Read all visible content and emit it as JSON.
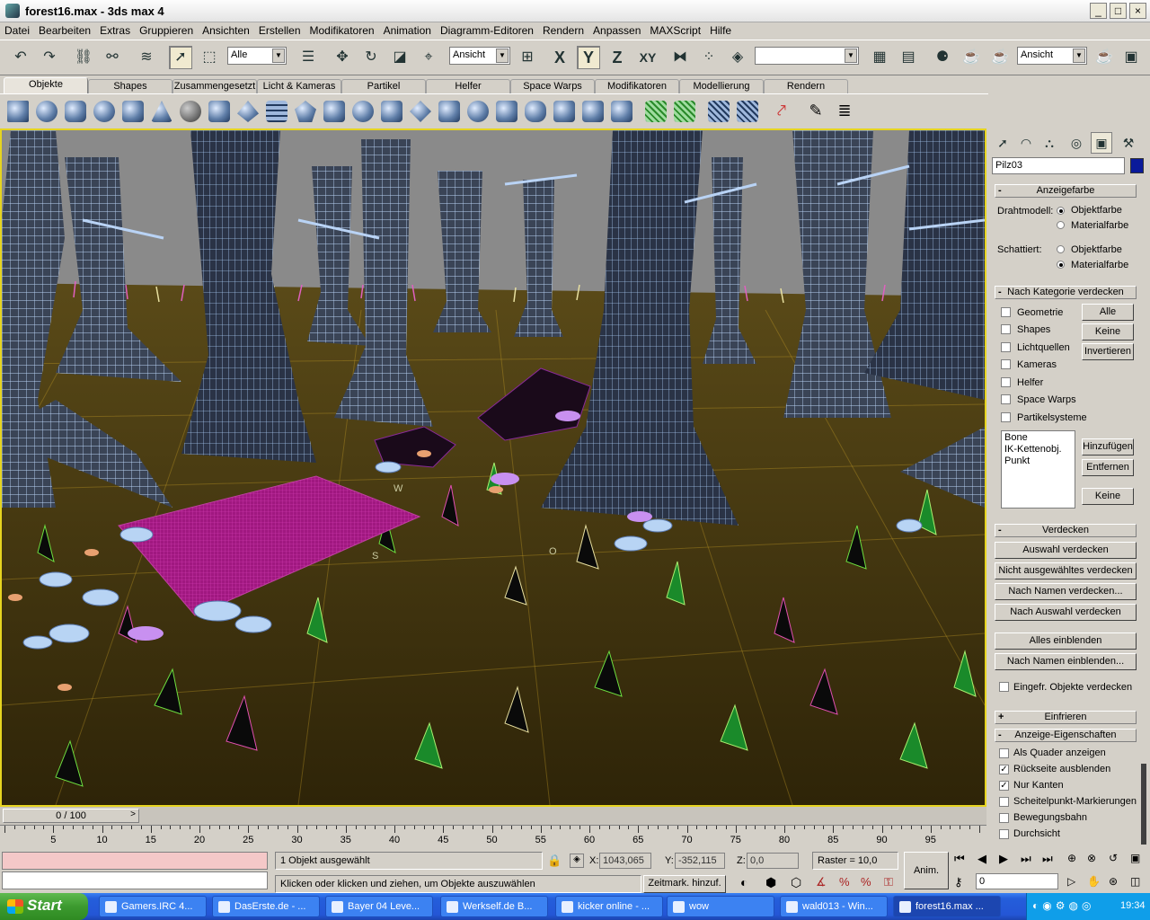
{
  "window": {
    "title": "forest16.max - 3ds max 4"
  },
  "menu": [
    "Datei",
    "Bearbeiten",
    "Extras",
    "Gruppieren",
    "Ansichten",
    "Erstellen",
    "Modifikatoren",
    "Animation",
    "Diagramm-Editoren",
    "Rendern",
    "Anpassen",
    "MAXScript",
    "Hilfe"
  ],
  "toolbar": {
    "filter": "Alle",
    "refcoord": "Ansicht",
    "axis_x": "X",
    "axis_y": "Y",
    "axis_z": "Z",
    "axis_xy": "XY",
    "render_view": "Ansicht"
  },
  "tabs": [
    "Objekte",
    "Shapes",
    "Zusammengesetzt",
    "Licht & Kameras",
    "Partikel",
    "Helfer",
    "Space Warps",
    "Modifikatoren",
    "Modellierung",
    "Rendern"
  ],
  "panel": {
    "object_name": "Pilz03",
    "rollout_display_color": "Anzeigefarbe",
    "wireframe_label": "Drahtmodell:",
    "shaded_label": "Schattiert:",
    "opt_object_color": "Objektfarbe",
    "opt_material_color": "Materialfarbe",
    "rollout_hide_by_category": "Nach Kategorie verdecken",
    "categories": [
      "Geometrie",
      "Shapes",
      "Lichtquellen",
      "Kameras",
      "Helfer",
      "Space Warps",
      "Partikelsysteme"
    ],
    "btn_all": "Alle",
    "btn_none": "Keine",
    "btn_invert": "Invertieren",
    "list_items": [
      "Bone",
      "IK-Kettenobj.",
      "Punkt"
    ],
    "btn_add": "Hinzufügen",
    "btn_remove": "Entfernen",
    "btn_none2": "Keine",
    "rollout_hide": "Verdecken",
    "btn_hide_sel": "Auswahl verdecken",
    "btn_hide_unsel": "Nicht ausgewähltes verdecken",
    "btn_hide_by_name": "Nach Namen verdecken...",
    "btn_hide_by_hit": "Nach Auswahl verdecken",
    "btn_unhide_all": "Alles einblenden",
    "btn_unhide_by_name": "Nach Namen einblenden...",
    "cb_hide_frozen": "Eingefr. Objekte verdecken",
    "rollout_freeze": "Einfrieren",
    "rollout_display_props": "Anzeige-Eigenschaften",
    "display_props": [
      {
        "label": "Als Quader anzeigen",
        "checked": false
      },
      {
        "label": "Rückseite ausblenden",
        "checked": true
      },
      {
        "label": "Nur Kanten",
        "checked": true
      },
      {
        "label": "Scheitelpunkt-Markierungen",
        "checked": false
      },
      {
        "label": "Bewegungsbahn",
        "checked": false
      },
      {
        "label": "Durchsicht",
        "checked": false
      }
    ]
  },
  "timeline": {
    "slider": "0 / 100",
    "ticks": [
      "5",
      "10",
      "15",
      "20",
      "25",
      "30",
      "35",
      "40",
      "45",
      "50",
      "55",
      "60",
      "65",
      "70",
      "75",
      "80",
      "85",
      "90",
      "95"
    ]
  },
  "status": {
    "selection": "1 Objekt ausgewählt",
    "prompt": "Klicken oder klicken und ziehen, um Objekte auszuwählen",
    "x_label": "X:",
    "x_value": "1043,065",
    "y_label": "Y:",
    "y_value": "-352,115",
    "z_label": "Z:",
    "z_value": "0,0",
    "grid": "Raster = 10,0",
    "anim": "Anim.",
    "add_key": "Zeitmark. hinzuf.",
    "frame": "0"
  },
  "viewport_labels": {
    "w": "W",
    "s": "S",
    "o": "O"
  },
  "taskbar": {
    "start": "Start",
    "tasks": [
      "Gamers.IRC 4...",
      "DasErste.de - ...",
      "Bayer 04 Leve...",
      "Werkself.de B...",
      "kicker online - ...",
      "wow",
      "wald013 - Win...",
      "forest16.max ..."
    ],
    "clock": "19:34"
  }
}
